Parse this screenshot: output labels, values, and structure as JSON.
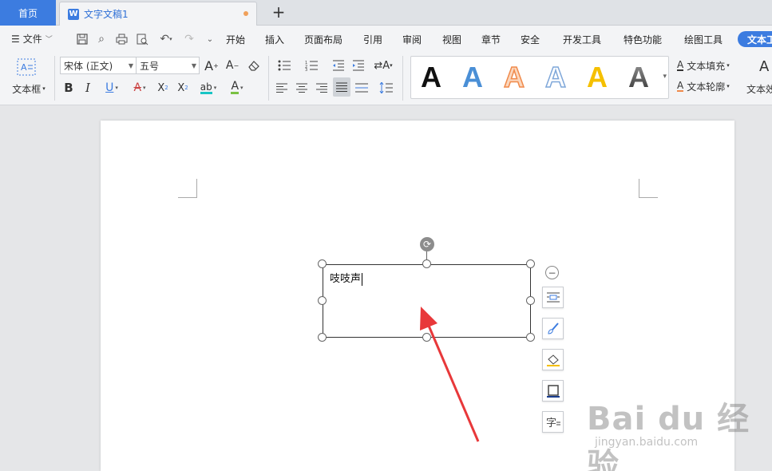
{
  "tabs": {
    "home": "首页",
    "document": "文字文稿1"
  },
  "menu": {
    "file": "文件",
    "items": [
      "开始",
      "插入",
      "页面布局",
      "引用",
      "审阅",
      "视图",
      "章节",
      "安全",
      "开发工具",
      "特色功能",
      "绘图工具"
    ],
    "active": "文本工"
  },
  "ribbon": {
    "textbox_label": "文本框",
    "font_name": "宋体 (正文)",
    "font_size": "五号",
    "text_fill": "文本填充",
    "text_outline": "文本轮廓",
    "text_effect": "文本效"
  },
  "colors": {
    "accent": "#3c7ce0",
    "style_black": "#111111",
    "style_blue": "#4a8fd6",
    "style_orange": "#f08a4b",
    "style_outline_blue": "#7fa7d9",
    "style_yellow": "#f5c000",
    "style_gray": "#555555",
    "arrow": "#e8383a"
  },
  "textbox": {
    "content": "吱吱声"
  },
  "watermark": {
    "brand": "Bai du 经验",
    "url": "jingyan.baidu.com"
  }
}
